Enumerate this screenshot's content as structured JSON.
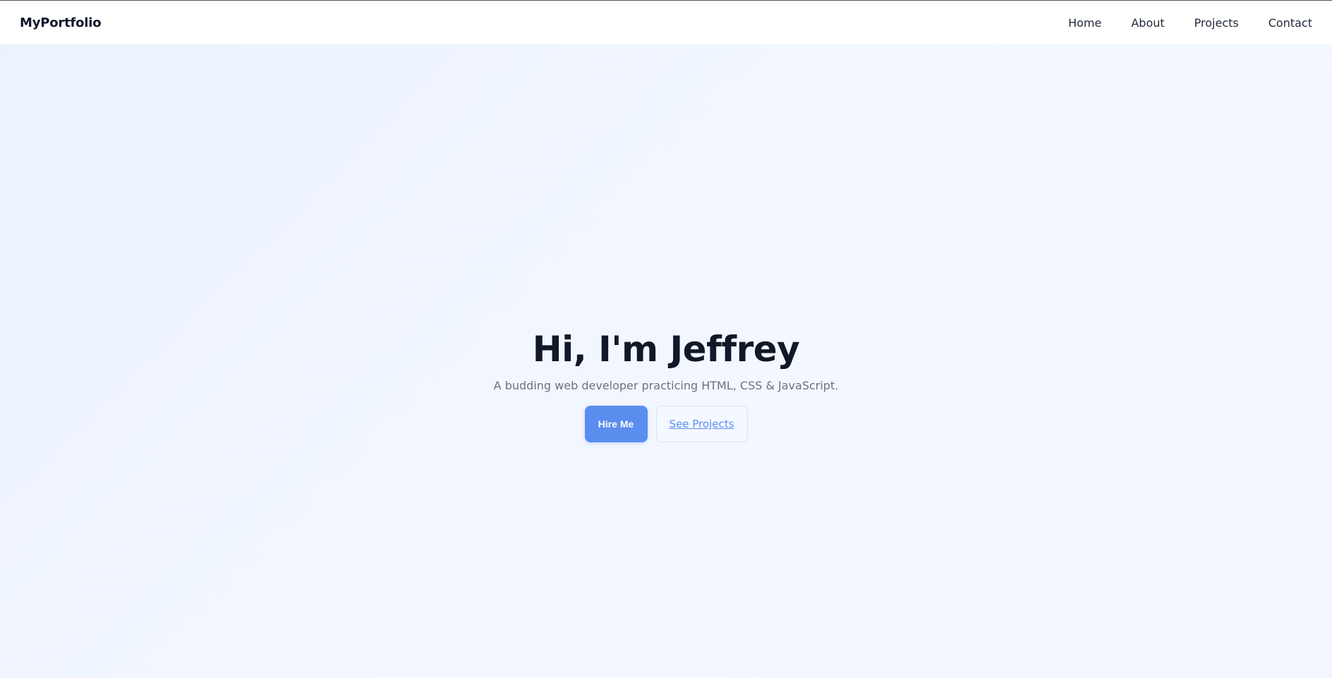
{
  "navbar": {
    "brand": "MyPortfolio",
    "links": [
      "Home",
      "About",
      "Projects",
      "Contact"
    ]
  },
  "hero": {
    "title": "Hi, I'm Jeffrey",
    "subtitle": "A budding web developer practicing HTML, CSS & JavaScript.",
    "primary_button": "Hire Me",
    "secondary_button": "See Projects"
  },
  "colors": {
    "accent": "#5b8def",
    "background": "#eef4fe",
    "text": "#111827",
    "muted": "#6b7280"
  }
}
